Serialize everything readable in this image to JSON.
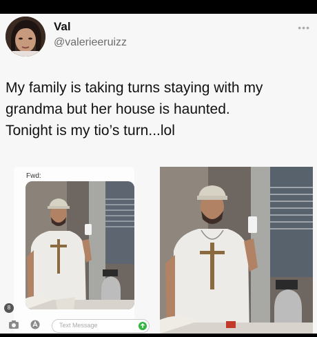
{
  "tweet": {
    "author_name": "Val",
    "author_handle": "@valerieeruizz",
    "more_icon": "ellipsis-icon",
    "text_line1": "My family is taking turns staying with my",
    "text_line2": "grandma but her house is haunted.",
    "text_line3": "Tonight is my tio’s turn...lol"
  },
  "message_screenshot": {
    "fwd_label": "Fwd:",
    "badge_count": "8",
    "input_placeholder": "Text Message",
    "camera_icon": "camera-icon",
    "appstore_icon": "app-store-icon",
    "send_icon": "send-arrow-icon",
    "send_color": "#38b544"
  },
  "colors": {
    "card_bg": "#f7f7f7",
    "frame_bg": "#000000"
  }
}
